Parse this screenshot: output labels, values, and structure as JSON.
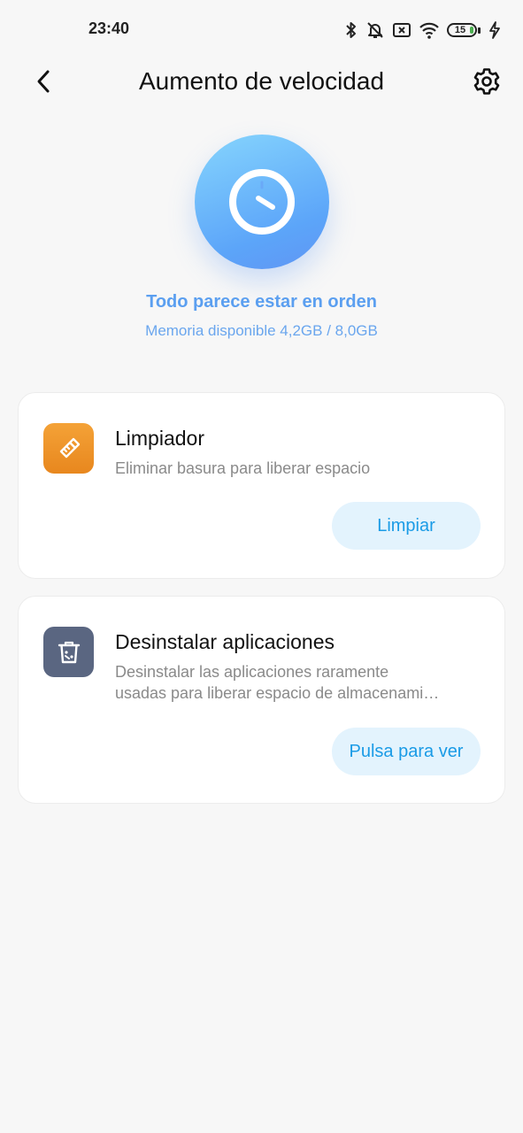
{
  "status_bar": {
    "time": "23:40",
    "battery_level": "15",
    "icons": [
      "bluetooth-icon",
      "mute-icon",
      "no-sim-icon",
      "wifi-icon",
      "battery-icon",
      "charging-icon"
    ]
  },
  "header": {
    "title": "Aumento de velocidad",
    "back_icon": "back-arrow-icon",
    "settings_icon": "gear-icon"
  },
  "hero": {
    "icon": "speedometer-icon",
    "headline": "Todo parece estar en orden",
    "memory": "Memoria disponible 4,2GB / 8,0GB"
  },
  "cards": [
    {
      "icon": "broom-icon",
      "title": "Limpiador",
      "description": "Eliminar basura para liberar espacio",
      "button": "Limpiar"
    },
    {
      "icon": "trash-icon",
      "title": "Desinstalar aplicaciones",
      "description_line1": "Desinstalar las aplicaciones raramente",
      "description_line2": "usadas para liberar espacio de almacenami…",
      "button": "Pulsa para ver"
    }
  ],
  "colors": {
    "accent_blue": "#1a9be6",
    "headline_blue": "#5b9ff0",
    "cleaner_orange": "#e8871e",
    "uninstall_slate": "#5a6681"
  }
}
